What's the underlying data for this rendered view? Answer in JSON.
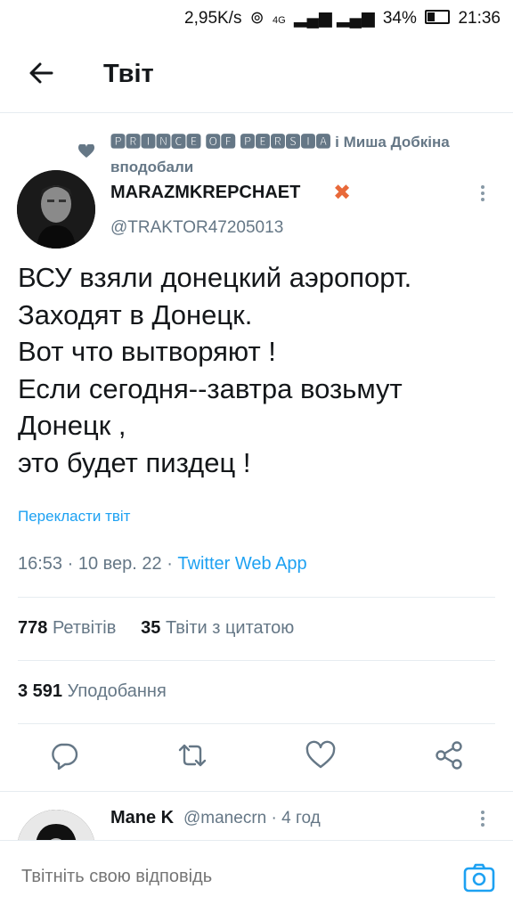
{
  "status_bar": {
    "speed": "2,95K/s",
    "network": "4G",
    "battery": "34%",
    "time": "21:36"
  },
  "header": {
    "title": "Твіт"
  },
  "liked_by": {
    "text": "🅿🆁🅸🅽🅲🅴 🅾🅵 🅿🅴🆁🆂🅸🅰 і Миша Добкіна вподобали"
  },
  "tweet": {
    "author_name": "MARAZMKREPCHAET",
    "author_mark": "✖",
    "handle": "@TRAKTOR47205013",
    "text": "ВСУ  взяли  донецкий аэропорт.\nЗаходят в Донецк.\nВот что вытворяют !\nЕсли сегодня--завтра  возьмут Донецк ,\nэто будет пиздец !",
    "translate": "Перекласти твіт",
    "time_date": "16:53 · 10 вер. 22 · ",
    "client": "Twitter Web App"
  },
  "stats": {
    "retweets_count": "778",
    "retweets_label": "Ретвітів",
    "quotes_count": "35",
    "quotes_label": "Твіти з цитатою",
    "likes_count": "3 591",
    "likes_label": "Уподобання"
  },
  "actions": [
    "reply-icon",
    "retweet-icon",
    "like-icon",
    "share-icon"
  ],
  "reply": {
    "name": "Mane K",
    "handle": "@manecrn · 4 год"
  },
  "compose": {
    "placeholder": "Твітніть свою відповідь"
  },
  "colors": {
    "accent": "#1da1f2",
    "secondary": "#657786",
    "text": "#14171a"
  }
}
